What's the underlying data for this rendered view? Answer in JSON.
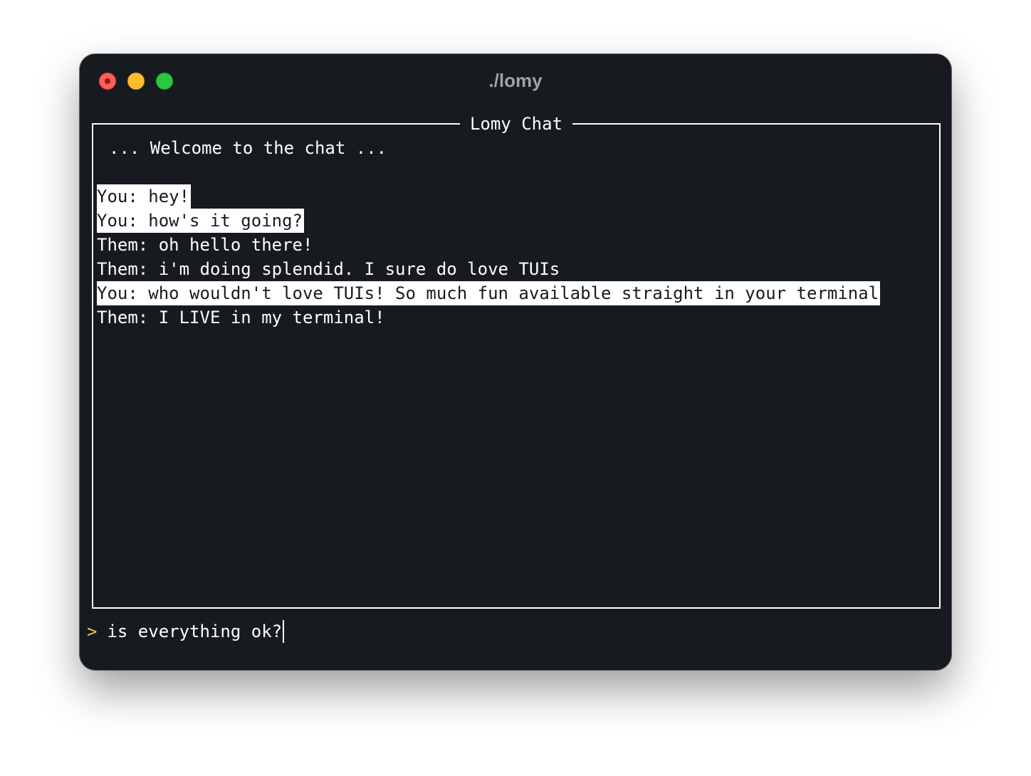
{
  "window": {
    "title": "./lomy"
  },
  "chat": {
    "title": "Lomy Chat",
    "welcome": "... Welcome to the chat ...",
    "messages": [
      {
        "sender": "you",
        "text": "You: hey!"
      },
      {
        "sender": "you",
        "text": "You: how's it going?"
      },
      {
        "sender": "them",
        "text": "Them: oh hello there!"
      },
      {
        "sender": "them",
        "text": "Them: i'm doing splendid. I sure do love TUIs"
      },
      {
        "sender": "you",
        "text": "You: who wouldn't love TUIs! So much fun available straight in your terminal"
      },
      {
        "sender": "them",
        "text": "Them: I LIVE in my terminal!"
      }
    ]
  },
  "input": {
    "prompt": ">",
    "value": "is everything ok?"
  },
  "colors": {
    "background": "#171b20",
    "foreground": "#ffffff",
    "prompt": "#e6c94a",
    "close": "#fe5f57",
    "minimize": "#febc2e",
    "zoom": "#28c840"
  }
}
